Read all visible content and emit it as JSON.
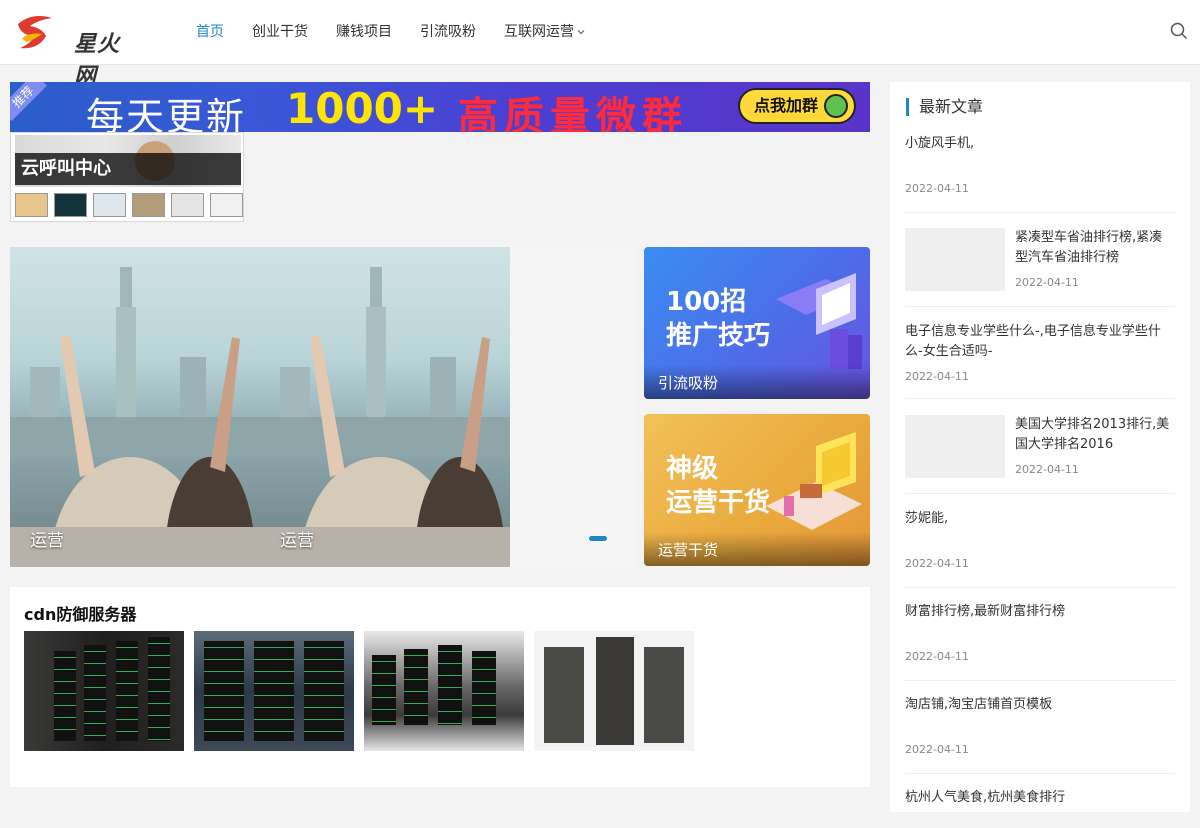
{
  "header": {
    "logo_text": "星火网",
    "nav": [
      {
        "label": "首页"
      },
      {
        "label": "创业干货"
      },
      {
        "label": "赚钱项目"
      },
      {
        "label": "引流吸粉"
      },
      {
        "label": "互联网运营"
      }
    ]
  },
  "banner": {
    "tag": "推荐",
    "text_1": "每天更新",
    "text_2": "1000+",
    "text_3": "高质量微群",
    "button": "点我加群"
  },
  "ad": {
    "title": "云呼叫中心"
  },
  "slider": {
    "slides": [
      {
        "label": "运营"
      },
      {
        "label": "运营"
      }
    ]
  },
  "promos": [
    {
      "title": "100招\n推广技巧",
      "caption": "引流吸粉"
    },
    {
      "title": "神级\n运营干货",
      "caption": "运营干货"
    }
  ],
  "cdn": {
    "title": "cdn防御服务器"
  },
  "sidebar": {
    "title": "最新文章",
    "articles": [
      {
        "title": "小旋风手机,",
        "date": "2022-04-11"
      },
      {
        "title": "紧凑型车省油排行榜,紧凑型汽车省油排行榜",
        "date": "2022-04-11"
      },
      {
        "title": "电子信息专业学些什么-,电子信息专业学些什么-女生合适吗-",
        "date": "2022-04-11"
      },
      {
        "title": "美国大学排名2013排行,美国大学排名2016",
        "date": "2022-04-11"
      },
      {
        "title": "莎妮能,",
        "date": "2022-04-11"
      },
      {
        "title": "财富排行榜,最新财富排行榜",
        "date": "2022-04-11"
      },
      {
        "title": "淘店铺,淘宝店铺首页模板",
        "date": "2022-04-11"
      },
      {
        "title": "杭州人气美食,杭州美食排行",
        "date": ""
      }
    ]
  },
  "colors": {
    "accent": "#1e88c7",
    "background": "#f3f3f3"
  }
}
